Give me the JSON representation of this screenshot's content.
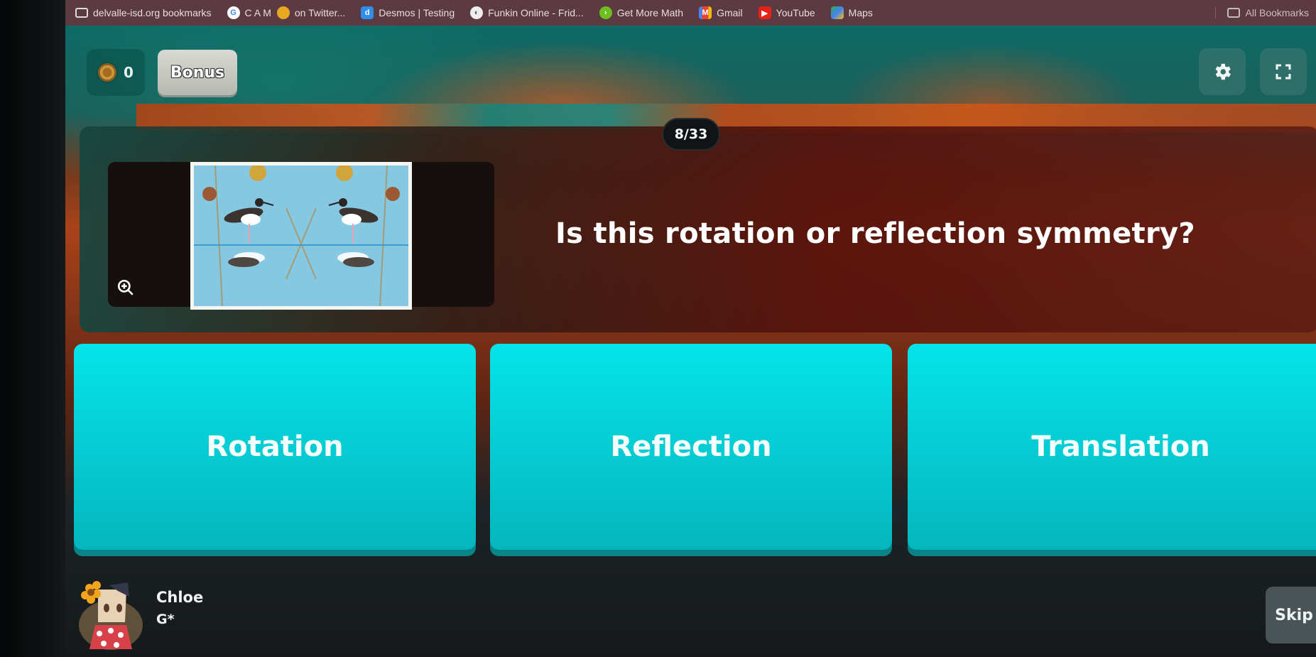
{
  "bookmarks_bar": {
    "items": [
      {
        "label": "delvalle-isd.org bookmarks",
        "icon": "folder-icon"
      },
      {
        "label": "C A M",
        "icon": "google-icon"
      },
      {
        "label": "on Twitter...",
        "icon": "twitter-emoji-icon"
      },
      {
        "label": "Desmos | Testing",
        "icon": "desmos-icon"
      },
      {
        "label": "Funkin Online - Frid...",
        "icon": "globe-icon"
      },
      {
        "label": "Get More Math",
        "icon": "get-more-math-icon"
      },
      {
        "label": "Gmail",
        "icon": "gmail-icon"
      },
      {
        "label": "YouTube",
        "icon": "youtube-icon"
      },
      {
        "label": "Maps",
        "icon": "maps-icon"
      }
    ],
    "right_label": "All Bookmarks"
  },
  "game": {
    "coins": "0",
    "bonus_label": "Bonus",
    "progress": {
      "current": 8,
      "total": 33,
      "label": "8/33"
    },
    "question": "Is this rotation or reflection symmetry?",
    "image_alt": "Mirrored photo of two stilt birds standing in water with reflections",
    "answers": [
      {
        "label": "Rotation"
      },
      {
        "label": "Reflection"
      },
      {
        "label": "Translation"
      }
    ],
    "accent_color": "#06d3da",
    "player": {
      "name": "Chloe",
      "sub": "G*"
    },
    "skip_label": "Skip"
  }
}
